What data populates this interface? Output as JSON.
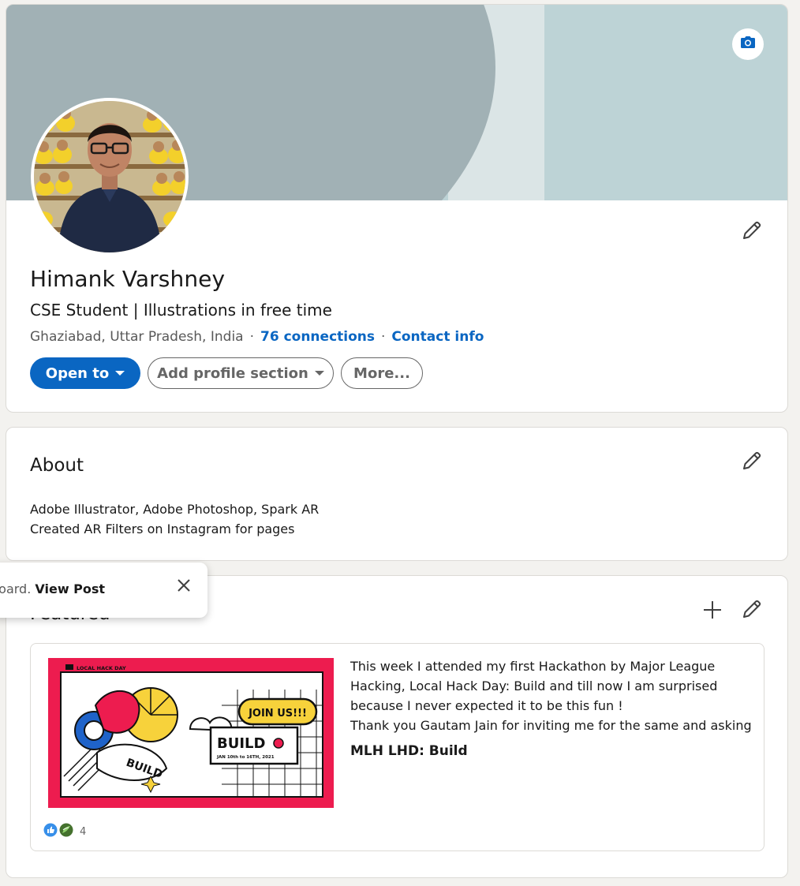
{
  "profile": {
    "name": "Himank Varshney",
    "headline": "CSE Student | Illustrations in free time",
    "location": "Ghaziabad, Uttar Pradesh, India",
    "separator": "·",
    "connections": "76 connections",
    "contact_info": "Contact info",
    "buttons": {
      "open_to": "Open to",
      "add_section": "Add profile section",
      "more": "More..."
    },
    "icons": {
      "banner_edit": "camera-icon",
      "intro_edit": "pencil-icon"
    }
  },
  "about": {
    "title": "About",
    "lines": [
      "Adobe Illustrator, Adobe Photoshop, Spark AR",
      "Created AR Filters on Instagram for pages"
    ]
  },
  "featured": {
    "title": "Featured",
    "item": {
      "thumbnail_texts": {
        "brand": "LOCAL HACK DAY",
        "cta": "JOIN US!!!",
        "title": "BUILD",
        "dates": "JAN 10th to 16TH, 2021"
      },
      "description_lines": [
        "This week I attended my first Hackathon by Major League",
        "Hacking, Local Hack Day: Build and till now I am surprised",
        "because I never expected it to be this fun !",
        "Thank you Gautam Jain for inviting me for the same and asking..."
      ],
      "title": "MLH LHD: Build",
      "reaction_count": "4"
    }
  },
  "toast": {
    "text": "board.",
    "link": "View Post"
  },
  "colors": {
    "brand_blue": "#0a66c2",
    "background": "#f3f2ef",
    "banner_light": "#bdd3d6",
    "banner_dark": "#a1b1b5",
    "thumbnail_red": "#ed1c4f"
  }
}
